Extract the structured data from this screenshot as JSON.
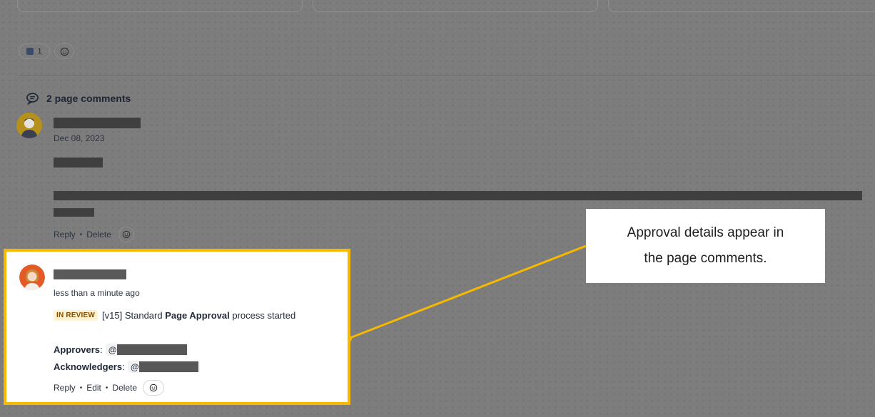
{
  "reactions": {
    "emoji_count": "1"
  },
  "comments_header": {
    "label": "2 page comments"
  },
  "comment1": {
    "date": "Dec 08, 2023",
    "actions": {
      "reply": "Reply",
      "delete": "Delete",
      "sep": "•"
    }
  },
  "comment2": {
    "time": "less than a minute ago",
    "status": "IN REVIEW",
    "message_prefix": "[v15] Standard ",
    "message_bold": "Page Approval",
    "message_suffix": " process started",
    "approvers_label": "Approvers",
    "acknowledgers_label": "Acknowledgers",
    "colon": ":",
    "at": "@",
    "actions": {
      "reply": "Reply",
      "edit": "Edit",
      "delete": "Delete",
      "sep": "•"
    }
  },
  "callout": {
    "line1": "Approval details appear in",
    "line2": "the page comments."
  },
  "colors": {
    "highlight_border": "#f7b800",
    "connector_line": "#f7b800",
    "overlay": "#7d7d7d",
    "status_bg": "#fff3cf",
    "status_text": "#8a4b00"
  }
}
